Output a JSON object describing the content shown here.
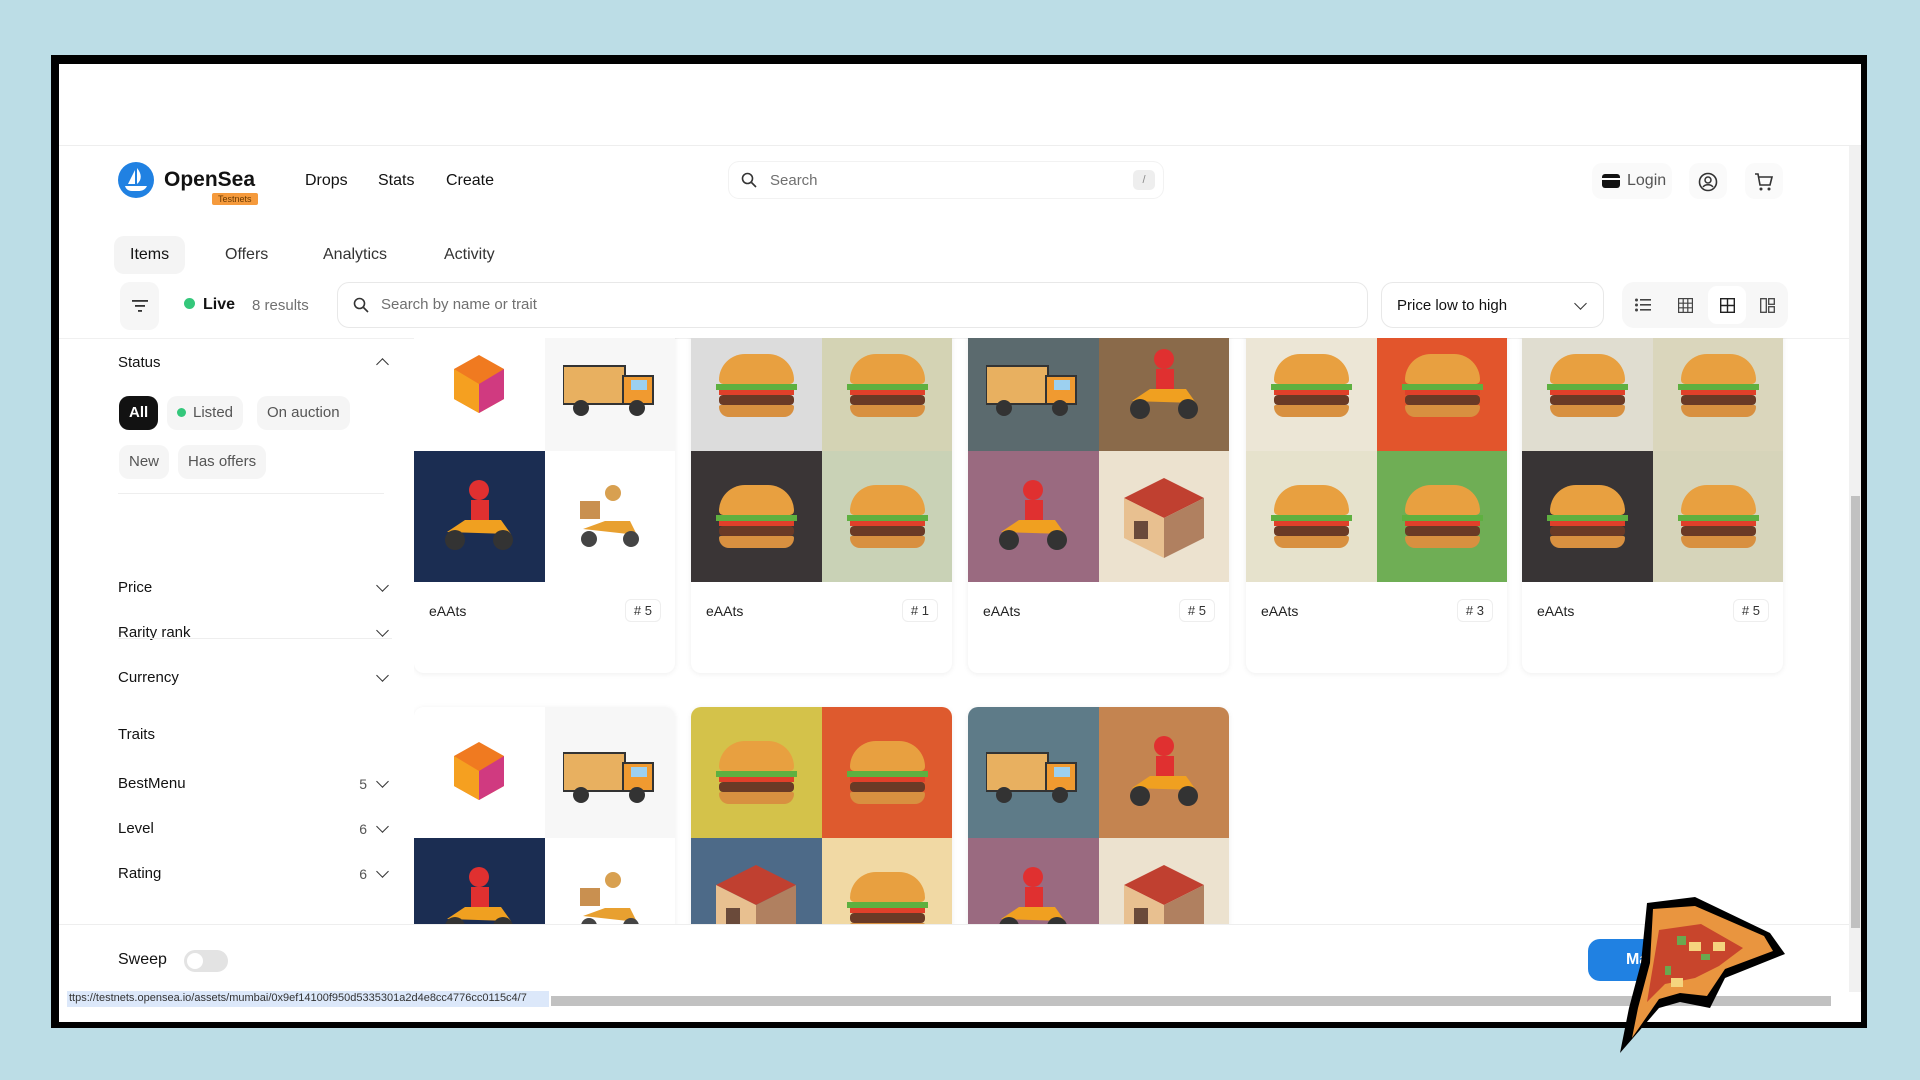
{
  "header": {
    "brand": "OpenSea",
    "badge": "Testnets",
    "nav": [
      "Drops",
      "Stats",
      "Create"
    ],
    "search_placeholder": "Search",
    "search_shortcut": "/",
    "login": "Login"
  },
  "tabs": [
    {
      "label": "Items",
      "active": true
    },
    {
      "label": "Offers"
    },
    {
      "label": "Analytics"
    },
    {
      "label": "Activity"
    }
  ],
  "toolbar": {
    "live": "Live",
    "results": "8 results",
    "search_placeholder": "Search by name or trait",
    "sort": "Price low to high",
    "views": [
      "list",
      "grid-small",
      "grid-medium",
      "grid-large"
    ],
    "active_view": "grid-medium"
  },
  "sidebar": {
    "status_title": "Status",
    "status_pills": [
      "All",
      "Listed",
      "On auction",
      "New",
      "Has offers"
    ],
    "filters": [
      "Price",
      "Rarity rank",
      "Currency"
    ],
    "traits_title": "Traits",
    "traits": [
      {
        "name": "BestMenu",
        "count": "5"
      },
      {
        "name": "Level",
        "count": "6"
      },
      {
        "name": "Rating",
        "count": "6"
      }
    ]
  },
  "items": [
    {
      "name": "eAAts",
      "num": "# 5",
      "quads": [
        [
          "#ffffff",
          "cube"
        ],
        [
          "#f7f7f7",
          "truck"
        ],
        [
          "#1b2d52",
          "scooter"
        ],
        [
          "#ffffff",
          "scooter2"
        ]
      ]
    },
    {
      "name": "eAAts",
      "num": "# 1",
      "quads": [
        [
          "#dcdcdc",
          "burger"
        ],
        [
          "#d4d3b4",
          "burger"
        ],
        [
          "#3a3536",
          "burger"
        ],
        [
          "#c9d2b6",
          "burger"
        ]
      ]
    },
    {
      "name": "eAAts",
      "num": "# 5",
      "quads": [
        [
          "#5b6a6e",
          "truck"
        ],
        [
          "#8a6a4a",
          "scooter"
        ],
        [
          "#9a6a80",
          "scooter"
        ],
        [
          "#ece2cf",
          "shop"
        ]
      ]
    },
    {
      "name": "eAAts",
      "num": "# 3",
      "quads": [
        [
          "#ece6d6",
          "burger"
        ],
        [
          "#e2552c",
          "burger"
        ],
        [
          "#e6e2cc",
          "burger"
        ],
        [
          "#6fae55",
          "burger"
        ]
      ]
    },
    {
      "name": "eAAts",
      "num": "# 5",
      "quads": [
        [
          "#e0ddd0",
          "burger"
        ],
        [
          "#dad6bc",
          "burger"
        ],
        [
          "#383435",
          "burger"
        ],
        [
          "#d6d4ba",
          "burger"
        ]
      ]
    },
    {
      "name": "",
      "num": "",
      "quads": [
        [
          "#ffffff",
          "cube"
        ],
        [
          "#f7f7f7",
          "truck"
        ],
        [
          "#1b2d52",
          "scooter"
        ],
        [
          "#ffffff",
          "scooter2"
        ]
      ]
    },
    {
      "name": "",
      "num": "",
      "quads": [
        [
          "#d4c24a",
          "burger"
        ],
        [
          "#de5a2e",
          "burger"
        ],
        [
          "#4d6a88",
          "shop"
        ],
        [
          "#f1d9a4",
          "burger"
        ]
      ]
    },
    {
      "name": "",
      "num": "",
      "quads": [
        [
          "#5e7b88",
          "truck"
        ],
        [
          "#c48450",
          "scooter"
        ],
        [
          "#9a6a80",
          "scooter"
        ],
        [
          "#ece2cf",
          "shop"
        ]
      ]
    }
  ],
  "footer": {
    "sweep": "Sweep",
    "sweep_on": false,
    "make_button": "Mak"
  },
  "status_url": "ttps://testnets.opensea.io/assets/mumbai/0x9ef14100f950d5335301a2d4e8cc4776cc0115c4/7",
  "colors": {
    "accent": "#2081e2",
    "live": "#34c77b",
    "testnets": "#f59a3c"
  }
}
